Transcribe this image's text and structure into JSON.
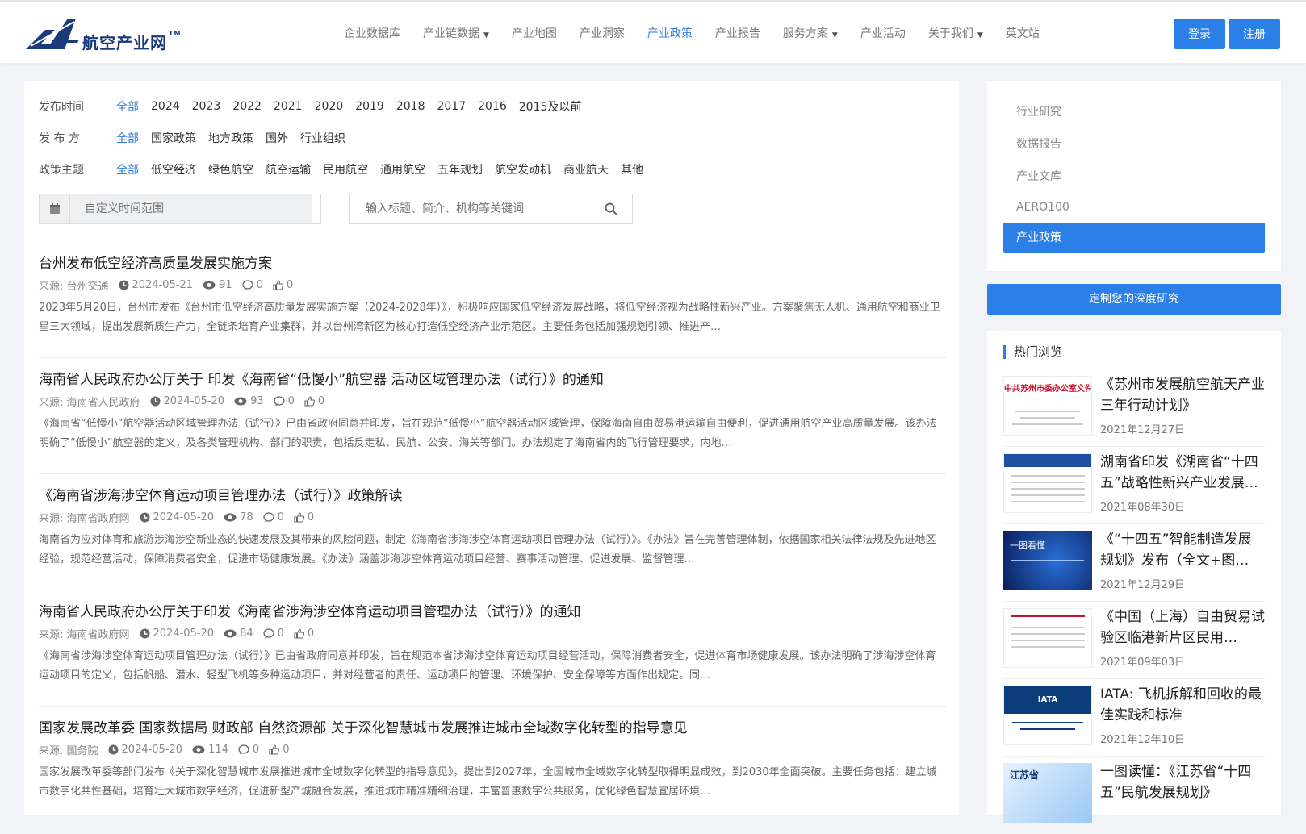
{
  "header": {
    "logo_text": "航空产业网",
    "logo_tm": "TM",
    "nav": [
      {
        "label": "企业数据库",
        "dropdown": false,
        "active": false
      },
      {
        "label": "产业链数据",
        "dropdown": true,
        "active": false
      },
      {
        "label": "产业地图",
        "dropdown": false,
        "active": false
      },
      {
        "label": "产业洞察",
        "dropdown": false,
        "active": false
      },
      {
        "label": "产业政策",
        "dropdown": false,
        "active": true
      },
      {
        "label": "产业报告",
        "dropdown": false,
        "active": false
      },
      {
        "label": "服务方案",
        "dropdown": true,
        "active": false
      },
      {
        "label": "产业活动",
        "dropdown": false,
        "active": false
      },
      {
        "label": "关于我们",
        "dropdown": true,
        "active": false
      },
      {
        "label": "英文站",
        "dropdown": false,
        "active": false
      }
    ],
    "login_label": "登录",
    "register_label": "注册"
  },
  "filters": {
    "time": {
      "label": "发布时间",
      "options": [
        "全部",
        "2024",
        "2023",
        "2022",
        "2021",
        "2020",
        "2019",
        "2018",
        "2017",
        "2016",
        "2015及以前"
      ]
    },
    "publisher": {
      "label": "发 布 方",
      "options": [
        "全部",
        "国家政策",
        "地方政策",
        "国外",
        "行业组织"
      ]
    },
    "topic": {
      "label": "政策主题",
      "options": [
        "全部",
        "低空经济",
        "绿色航空",
        "航空运输",
        "民用航空",
        "通用航空",
        "五年规划",
        "航空发动机",
        "商业航天",
        "其他"
      ]
    },
    "date_placeholder": "自定义时间范围",
    "search_placeholder": "输入标题、简介、机构等关键词"
  },
  "articles": [
    {
      "title": "台州发布低空经济高质量发展实施方案",
      "source": "来源: 台州交通",
      "date": "2024-05-21",
      "views": "91",
      "comments": "0",
      "likes": "0",
      "desc": "2023年5月20日，台州市发布《台州市低空经济高质量发展实施方案（2024-2028年）》，积极响应国家低空经济发展战略，将低空经济视为战略性新兴产业。方案聚焦无人机、通用航空和商业卫星三大领域，提出发展新质生产力，全链条培育产业集群，并以台州湾新区为核心打造低空经济产业示范区。主要任务包括加强规划引领、推进产…"
    },
    {
      "title": "海南省人民政府办公厅关于 印发《海南省“低慢小”航空器 活动区域管理办法（试行）》的通知",
      "source": "来源: 海南省人民政府",
      "date": "2024-05-20",
      "views": "93",
      "comments": "0",
      "likes": "0",
      "desc": "《海南省“低慢小”航空器活动区域管理办法（试行）》已由省政府同意并印发，旨在规范“低慢小”航空器活动区域管理，保障海南自由贸易港运输自由便利，促进通用航空产业高质量发展。该办法明确了“低慢小”航空器的定义，及各类管理机构、部门的职责，包括反走私、民航、公安、海关等部门。办法规定了海南省内的飞行管理要求，内地…"
    },
    {
      "title": "《海南省涉海涉空体育运动项目管理办法（试行）》政策解读",
      "source": "来源: 海南省政府网",
      "date": "2024-05-20",
      "views": "78",
      "comments": "0",
      "likes": "0",
      "desc": "海南省为应对体育和旅游涉海涉空新业态的快速发展及其带来的风险问题，制定《海南省涉海涉空体育运动项目管理办法（试行）》。《办法》旨在完善管理体制，依据国家相关法律法规及先进地区经验，规范经营活动，保障消费者安全，促进市场健康发展。《办法》涵盖涉海涉空体育运动项目经营、赛事活动管理、促进发展、监督管理…"
    },
    {
      "title": "海南省人民政府办公厅关于印发《海南省涉海涉空体育运动项目管理办法（试行）》的通知",
      "source": "来源: 海南省政府网",
      "date": "2024-05-20",
      "views": "84",
      "comments": "0",
      "likes": "0",
      "desc": "《海南省涉海涉空体育运动项目管理办法（试行）》已由省政府同意并印发，旨在规范本省涉海涉空体育运动项目经营活动，保障消费者安全，促进体育市场健康发展。该办法明确了涉海涉空体育运动项目的定义，包括帆船、潜水、轻型飞机等多种运动项目，并对经营者的责任、运动项目的管理、环境保护、安全保障等方面作出规定。同…"
    },
    {
      "title": "国家发展改革委 国家数据局 财政部 自然资源部 关于深化智慧城市发展推进城市全域数字化转型的指导意见",
      "source": "来源: 国务院",
      "date": "2024-05-20",
      "views": "114",
      "comments": "0",
      "likes": "0",
      "desc": "国家发展改革委等部门发布《关于深化智慧城市发展推进城市全域数字化转型的指导意见》，提出到2027年，全国城市全域数字化转型取得明显成效，到2030年全面突破。主要任务包括：建立城市数字化共性基础，培育壮大城市数字经济，促进新型产城融合发展，推进城市精准精细治理，丰富普惠数字公共服务，优化绿色智慧宜居环境…"
    }
  ],
  "side_menu": [
    {
      "label": "行业研究",
      "active": false
    },
    {
      "label": "数据报告",
      "active": false
    },
    {
      "label": "产业文库",
      "active": false
    },
    {
      "label": "AERO100",
      "active": false
    },
    {
      "label": "产业政策",
      "active": true
    }
  ],
  "custom_button": "定制您的深度研究",
  "hot": {
    "heading": "热门浏览",
    "items": [
      {
        "title": "《苏州市发展航空航天产业三年行动计划》",
        "date": "2021年12月27日",
        "thumb_text": "中共苏州市委办公室文件"
      },
      {
        "title": "湖南省印发《湖南省“十四五”战略性新兴产业发展…",
        "date": "2021年08年30日",
        "thumb_text": ""
      },
      {
        "title": "《“十四五”智能制造发展规划》发布（全文+图…",
        "date": "2021年12月29日",
        "thumb_text": "一图看懂"
      },
      {
        "title": "《中国（上海）自由贸易试验区临港新片区民用…",
        "date": "2021年09年03日",
        "thumb_text": ""
      },
      {
        "title": "IATA: 飞机拆解和回收的最佳实践和标准",
        "date": "2021年12年10日",
        "thumb_text": "IATA"
      },
      {
        "title": "一图读懂：《江苏省“十四五”民航发展规划》",
        "date": "",
        "thumb_text": "江苏省"
      }
    ]
  },
  "colors": {
    "accent": "#2a80e6",
    "active_text": "#2f7ddf",
    "logo": "#1a3a7a"
  }
}
